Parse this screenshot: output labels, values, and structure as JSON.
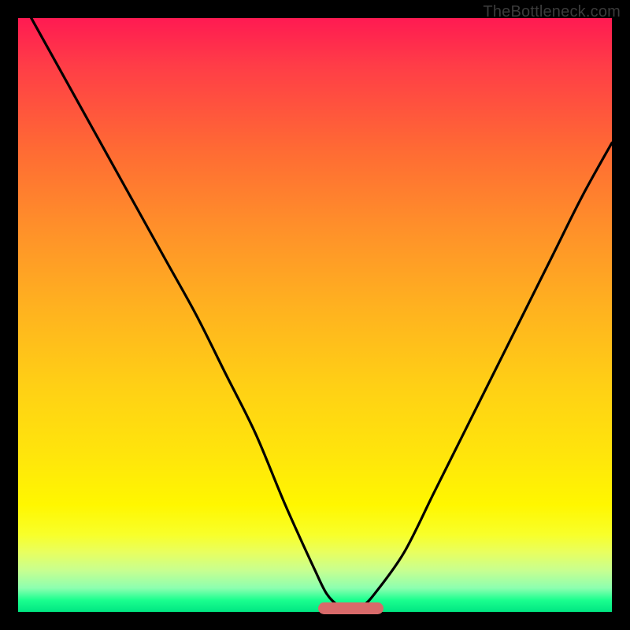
{
  "watermark": "TheBottleneck.com",
  "colors": {
    "frame": "#000000",
    "curve": "#000000",
    "marker": "#d86a6a",
    "gradient_top": "#ff1a52",
    "gradient_bottom": "#00e682"
  },
  "chart_data": {
    "type": "line",
    "title": "",
    "xlabel": "",
    "ylabel": "",
    "xlim": [
      0,
      100
    ],
    "ylim": [
      0,
      100
    ],
    "x": [
      0,
      5,
      10,
      15,
      20,
      25,
      30,
      35,
      40,
      45,
      50,
      52,
      54,
      56,
      58,
      60,
      65,
      70,
      75,
      80,
      85,
      90,
      95,
      100
    ],
    "values": [
      104,
      95,
      86,
      77,
      68,
      59,
      50,
      40,
      30,
      18,
      7,
      3,
      1,
      0,
      1,
      3,
      10,
      20,
      30,
      40,
      50,
      60,
      70,
      79
    ],
    "notes": "V-shaped bottleneck curve; minimum (0%) near x≈56 where the highlighted marker sits. Left branch starts above the visible top edge (~104%). Right branch ends around y≈79% at x=100.",
    "marker": {
      "x_center": 56,
      "y": 0,
      "width_percent": 11
    }
  }
}
